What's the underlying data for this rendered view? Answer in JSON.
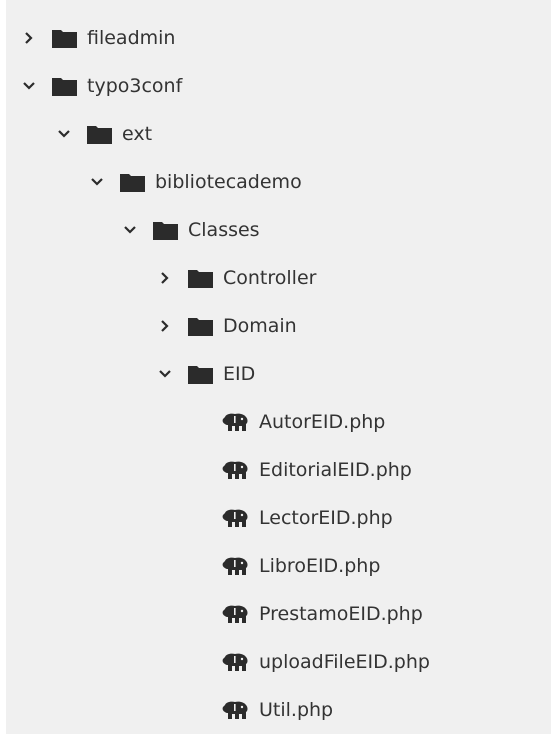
{
  "colors": {
    "panel_bg": "#f0f0f0",
    "text": "#333333",
    "icon": "#2b2b2b"
  },
  "tree": {
    "items": [
      {
        "label": "fileadmin",
        "type": "folder",
        "state": "collapsed",
        "icon": "folder-icon"
      },
      {
        "label": "typo3conf",
        "type": "folder",
        "state": "expanded",
        "icon": "folder-icon"
      },
      {
        "label": "ext",
        "type": "folder",
        "state": "expanded",
        "icon": "folder-icon"
      },
      {
        "label": "bibliotecademo",
        "type": "folder",
        "state": "expanded",
        "icon": "folder-icon"
      },
      {
        "label": "Classes",
        "type": "folder",
        "state": "expanded",
        "icon": "folder-icon"
      },
      {
        "label": "Controller",
        "type": "folder",
        "state": "collapsed",
        "icon": "folder-icon"
      },
      {
        "label": "Domain",
        "type": "folder",
        "state": "collapsed",
        "icon": "folder-icon"
      },
      {
        "label": "EID",
        "type": "folder",
        "state": "expanded",
        "icon": "folder-icon"
      },
      {
        "label": "AutorEID.php",
        "type": "file",
        "icon": "php-elephant-icon"
      },
      {
        "label": "EditorialEID.php",
        "type": "file",
        "icon": "php-elephant-icon"
      },
      {
        "label": "LectorEID.php",
        "type": "file",
        "icon": "php-elephant-icon"
      },
      {
        "label": "LibroEID.php",
        "type": "file",
        "icon": "php-elephant-icon"
      },
      {
        "label": "PrestamoEID.php",
        "type": "file",
        "icon": "php-elephant-icon"
      },
      {
        "label": "uploadFileEID.php",
        "type": "file",
        "icon": "php-elephant-icon"
      },
      {
        "label": "Util.php",
        "type": "file",
        "icon": "php-elephant-icon"
      }
    ]
  }
}
